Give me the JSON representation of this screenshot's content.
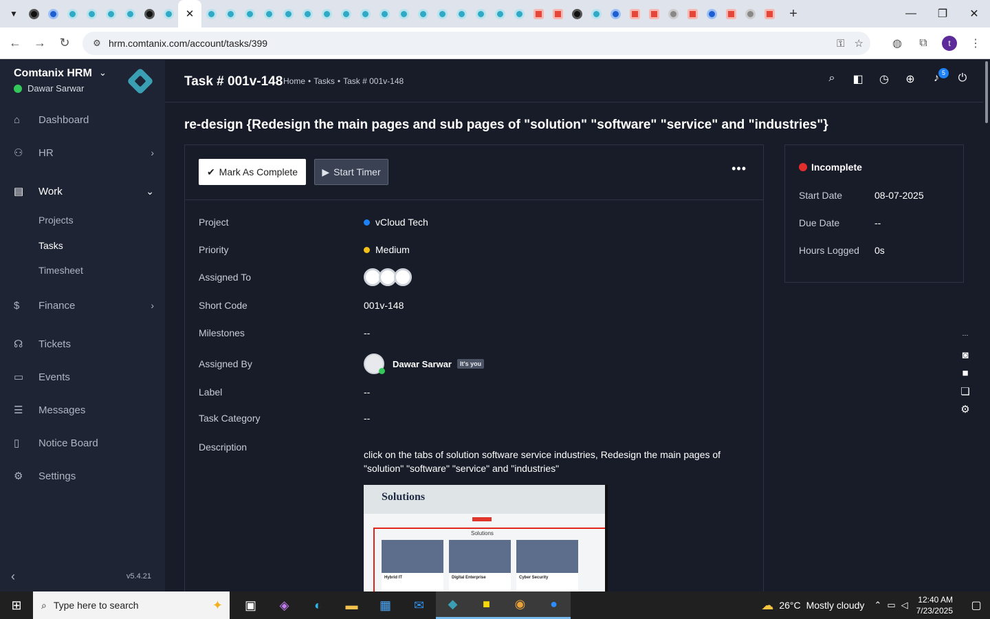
{
  "browser": {
    "active_tab_close": "✕",
    "new_tab": "+",
    "url": "hrm.comtanix.com/account/tasks/399",
    "profile_initial": "t"
  },
  "sidebar": {
    "brand": "Comtanix HRM",
    "user": "Dawar Sarwar",
    "items": [
      {
        "label": "Dashboard"
      },
      {
        "label": "HR"
      },
      {
        "label": "Work"
      },
      {
        "label": "Finance"
      },
      {
        "label": "Tickets"
      },
      {
        "label": "Events"
      },
      {
        "label": "Messages"
      },
      {
        "label": "Notice Board"
      },
      {
        "label": "Settings"
      }
    ],
    "work_submenu": [
      "Projects",
      "Tasks",
      "Timesheet"
    ],
    "version": "v5.4.21"
  },
  "header": {
    "title": "Task # 001v-148",
    "breadcrumb": [
      "Home",
      "•",
      "Tasks",
      "•",
      "Task # 001v-148"
    ],
    "notification_count": "5"
  },
  "task": {
    "heading": "re-design {Redesign the main pages and sub pages of \"solution\" \"software\" \"service\" and \"industries\"}",
    "mark_complete_label": "Mark As Complete",
    "start_timer_label": "Start Timer",
    "more_label": "•••",
    "fields": {
      "project_label": "Project",
      "project_value": "vCloud Tech",
      "priority_label": "Priority",
      "priority_value": "Medium",
      "assigned_to_label": "Assigned To",
      "short_code_label": "Short Code",
      "short_code_value": "001v-148",
      "milestones_label": "Milestones",
      "milestones_value": "--",
      "assigned_by_label": "Assigned By",
      "assigned_by_value": "Dawar Sarwar",
      "its_you": "It's you",
      "label_label": "Label",
      "label_value": "--",
      "category_label": "Task Category",
      "category_value": "--",
      "description_label": "Description"
    },
    "description": "click on the tabs of solution software service industries, Redesign the main pages of \"solution\" \"software\" \"service\" and \"industries\"",
    "image": {
      "title": "Solutions",
      "subtitle": "Solutions",
      "cards": [
        "Hybrid IT",
        "Digital Enterprise",
        "Cyber Security"
      ]
    }
  },
  "status": {
    "label": "Incomplete",
    "start_date_label": "Start Date",
    "start_date_value": "08-07-2025",
    "due_date_label": "Due Date",
    "due_date_value": "--",
    "hours_label": "Hours Logged",
    "hours_value": "0s"
  },
  "taskbar": {
    "search_placeholder": "Type here to search",
    "weather_temp": "26°C",
    "weather_text": "Mostly cloudy",
    "time": "12:40 AM",
    "date": "7/23/2025"
  },
  "colors": {
    "project_dot": "#1d82f5",
    "priority_dot": "#f5c118",
    "status_dot": "#e22d2d"
  }
}
